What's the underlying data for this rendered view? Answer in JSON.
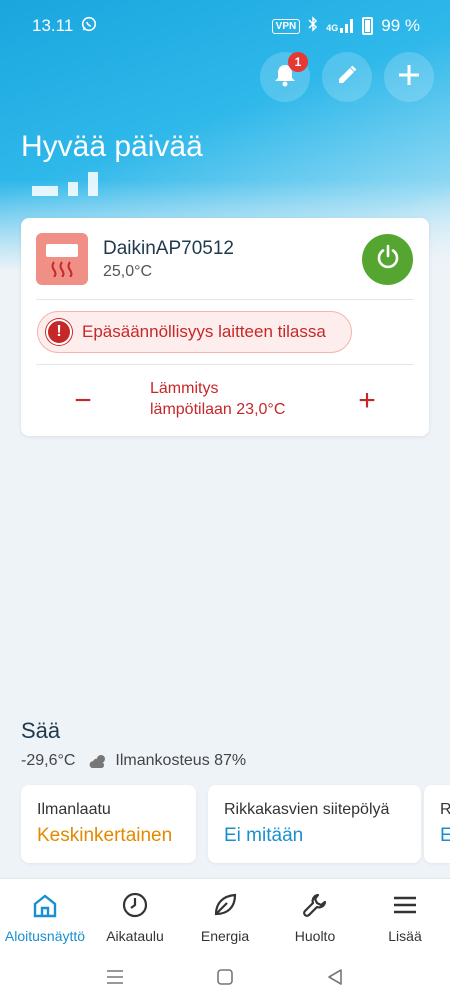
{
  "status_bar": {
    "time": "13.11",
    "vpn": "VPN",
    "network": "4G",
    "battery": "99 %"
  },
  "header": {
    "greeting": "Hyvää päivää",
    "notification_count": "1"
  },
  "device": {
    "name": "DaikinAP70512",
    "temperature": "25,0°C",
    "warning": "Epäsäännöllisyys laitteen tilassa",
    "mode_line1": "Lämmitys",
    "mode_line2": "lämpötilaan 23,0°C",
    "minus_symbol": "−",
    "plus_symbol": "+"
  },
  "weather": {
    "title": "Sää",
    "temperature": "-29,6°C",
    "humidity": "Ilmankosteus 87%"
  },
  "cards": [
    {
      "label": "Ilmanlaatu",
      "value": "Keskinkertainen",
      "color": "#e08a00"
    },
    {
      "label": "Rikkakasvien siitepölyä",
      "value": "Ei mitään",
      "color": "#1a8fcf"
    },
    {
      "label": "R",
      "value": "E",
      "color": "#1a8fcf"
    }
  ],
  "nav": {
    "items": [
      {
        "label": "Aloitusnäyttö",
        "icon": "home-icon",
        "active": true
      },
      {
        "label": "Aikataulu",
        "icon": "clock-icon",
        "active": false
      },
      {
        "label": "Energia",
        "icon": "leaf-icon",
        "active": false
      },
      {
        "label": "Huolto",
        "icon": "wrench-icon",
        "active": false
      },
      {
        "label": "Lisää",
        "icon": "menu-icon",
        "active": false
      }
    ]
  },
  "colors": {
    "accent": "#1a8fcf",
    "power_on": "#55a630",
    "error": "#c62828",
    "heating_tile": "#f08f86"
  }
}
